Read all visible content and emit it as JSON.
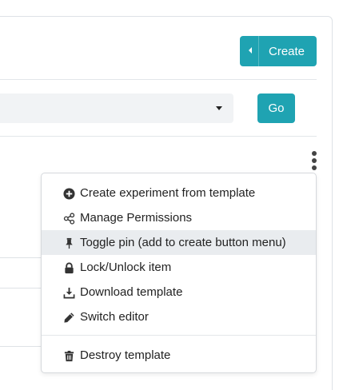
{
  "toolbar": {
    "create_label": "Create",
    "go_label": "Go"
  },
  "filter": {
    "selected_value": ""
  },
  "menu": {
    "items": [
      {
        "label": "Create experiment from template",
        "icon": "plus-circle-icon"
      },
      {
        "label": "Manage Permissions",
        "icon": "share-nodes-icon"
      },
      {
        "label": "Toggle pin (add to create button menu)",
        "icon": "thumbtack-icon",
        "highlighted": true
      },
      {
        "label": "Lock/Unlock item",
        "icon": "lock-icon"
      },
      {
        "label": "Download template",
        "icon": "download-icon"
      },
      {
        "label": "Switch editor",
        "icon": "pencil-icon"
      }
    ],
    "danger_item": {
      "label": "Destroy template",
      "icon": "trash-icon"
    }
  },
  "colors": {
    "accent": "#1fa3b2",
    "highlight": "#e9ecef",
    "border": "#dee2e6"
  }
}
